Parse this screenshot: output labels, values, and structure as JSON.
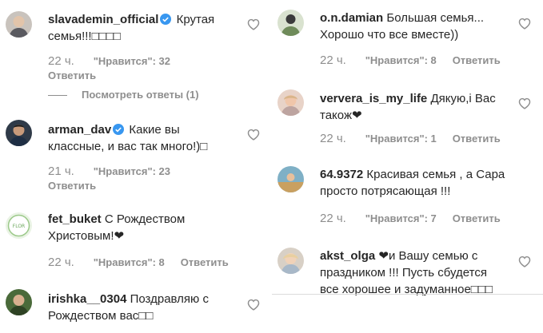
{
  "left": [
    {
      "username": "slavademin_official",
      "verified": true,
      "text_line1": "Крутая",
      "text_line2": "семья!!!□□□□",
      "time": "22 ч.",
      "likes": "\"Нравится\": 32",
      "reply": "Ответить",
      "view_replies": "Посмотреть ответы (1)"
    },
    {
      "username": "arman_dav",
      "verified": true,
      "text_line1": "Какие вы",
      "text_line2": "классные, и вас так много!)□",
      "time": "21 ч.",
      "likes": "\"Нравится\": 23",
      "reply": "Ответить"
    },
    {
      "username": "fet_buket",
      "verified": false,
      "text_line1": "С Рождеством",
      "text_line2": "Христовым!❤",
      "time": "22 ч.",
      "likes": "\"Нравится\": 8",
      "reply": "Ответить"
    },
    {
      "username": "irishka__0304",
      "verified": false,
      "text_line1": "Поздравляю с",
      "text_line2": "Рождеством вас□□"
    }
  ],
  "right": [
    {
      "username": "o.n.damian",
      "text_line1": "Большая семья...",
      "text_line2": "Хорошо что все вместе))",
      "time": "22 ч.",
      "likes": "\"Нравится\": 8",
      "reply": "Ответить"
    },
    {
      "username": "ververa_is_my_life",
      "text_line1": "Дякую,і Вас",
      "text_line2": "також❤",
      "time": "22 ч.",
      "likes": "\"Нравится\": 1",
      "reply": "Ответить"
    },
    {
      "username": "64.9372",
      "text_line1": "Красивая семья , а Сара",
      "text_line2": "просто потрясающая !!!",
      "time": "22 ч.",
      "likes": "\"Нравится\": 7",
      "reply": "Ответить"
    },
    {
      "username": "akst_olga",
      "text_line1": "❤и Вашу семью с",
      "text_line2": "праздником !!! Пусть сбудется",
      "text_line3": "все хорошее и задуманное□□□"
    }
  ],
  "icons": {
    "heart": "heart-outline-icon",
    "verified": "verified-badge-icon"
  },
  "colors": {
    "verified": "#3897f0",
    "meta": "#8e8e8e",
    "text": "#262626"
  }
}
